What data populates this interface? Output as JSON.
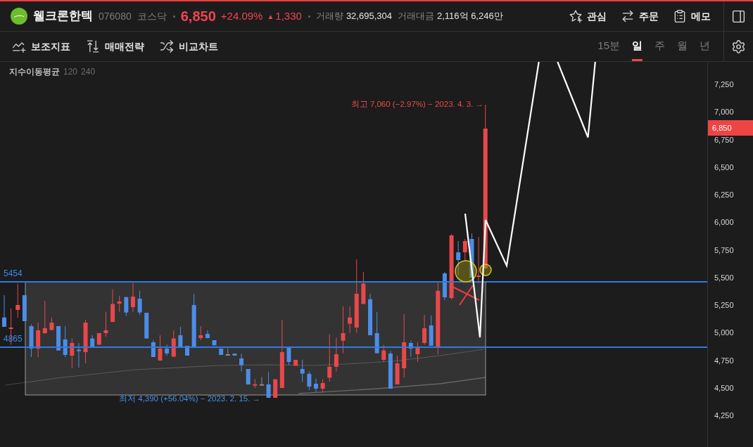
{
  "stock": {
    "name": "웰크론한텍",
    "code": "076080",
    "market": "코스닥",
    "price": "6,850",
    "change_rate": "+24.09%",
    "change_arrow": "▲",
    "change": "1,330",
    "stats": [
      {
        "label": "거래량",
        "value": "32,695,304"
      },
      {
        "label": "거래대금",
        "value": "2,116억 6,246만"
      }
    ]
  },
  "header_actions": [
    {
      "kind": "watchlist",
      "label": "관심"
    },
    {
      "kind": "order",
      "label": "주문"
    },
    {
      "kind": "memo",
      "label": "메모"
    }
  ],
  "toolbar": {
    "tools": [
      {
        "kind": "indicator",
        "label": "보조지표"
      },
      {
        "kind": "strategy",
        "label": "매매전략"
      },
      {
        "kind": "compare",
        "label": "비교차트"
      }
    ],
    "periods": [
      {
        "label": "15분",
        "selected": false
      },
      {
        "label": "일",
        "selected": true
      },
      {
        "label": "주",
        "selected": false
      },
      {
        "label": "월",
        "selected": false
      },
      {
        "label": "년",
        "selected": false
      }
    ]
  },
  "chart": {
    "indicator": {
      "name": "지수이동평균",
      "periods": [
        "120",
        "240"
      ]
    },
    "level_lines": [
      {
        "label": "5454"
      },
      {
        "label": "4865"
      }
    ],
    "high_note": "최고 7,060 (−2.97%) − 2023. 4. 3. →",
    "low_note": "최저 4,390 (+56.04%) − 2023. 2. 15. →",
    "y_axis": [
      "7,250",
      "7,000",
      "6,750",
      "6,500",
      "6,250",
      "6,000",
      "5,750",
      "5,500",
      "5,250",
      "5,000",
      "4,750",
      "4,500",
      "4,250"
    ],
    "current_price": "6,850"
  }
}
